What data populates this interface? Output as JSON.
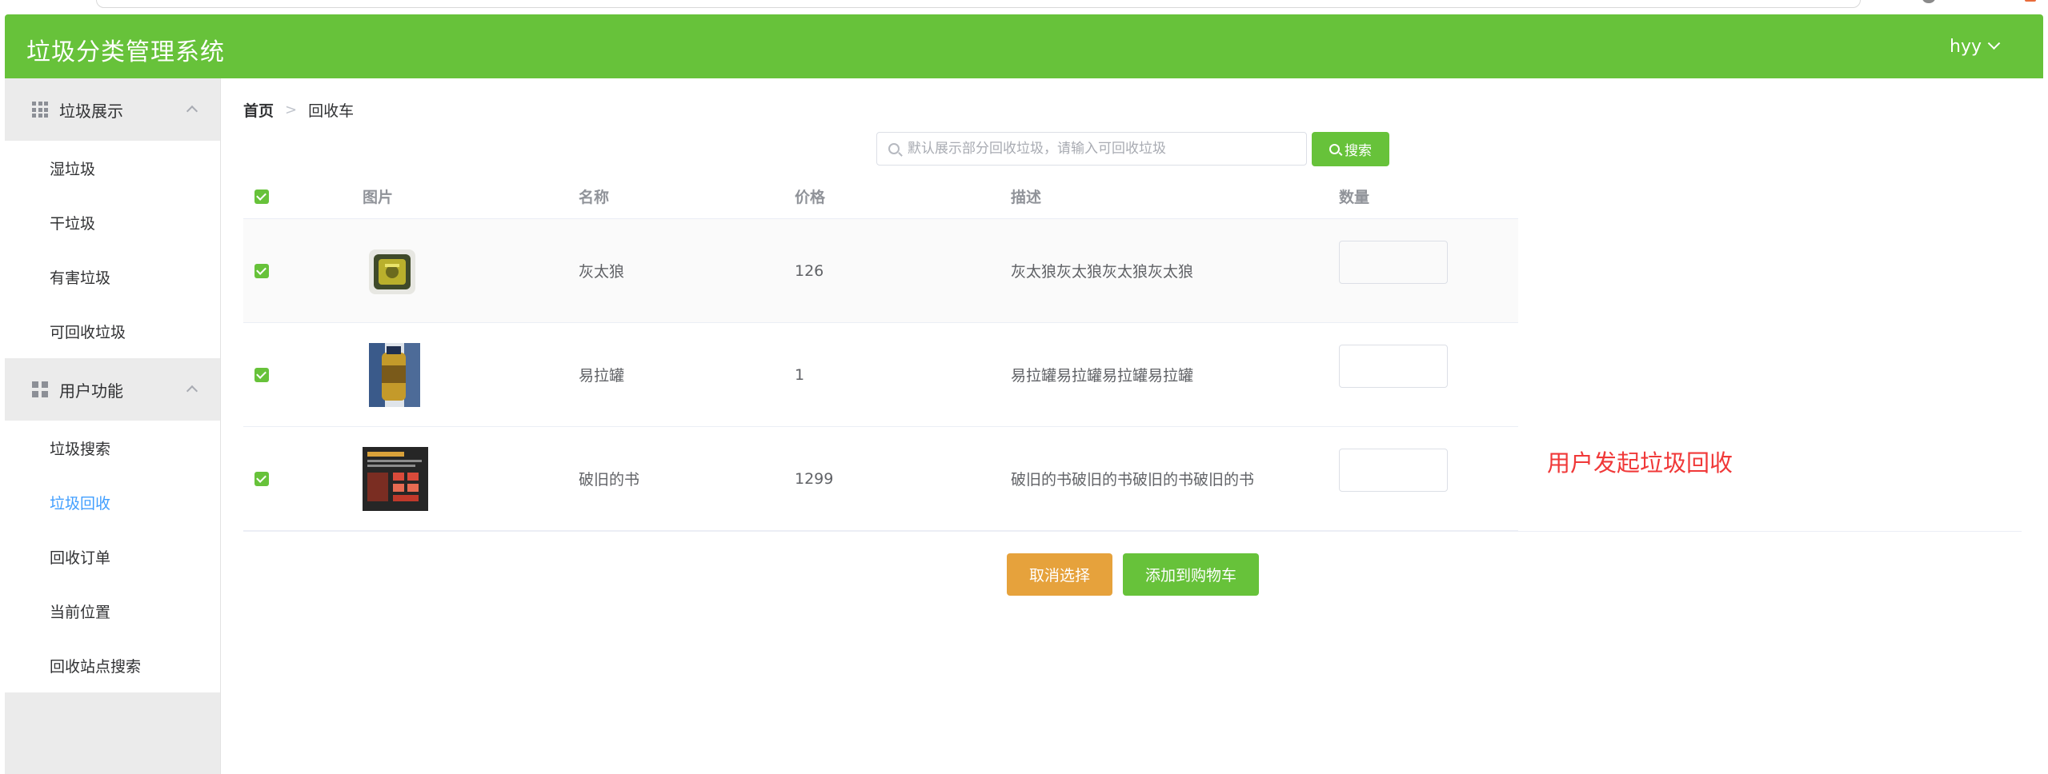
{
  "header": {
    "title": "垃圾分类管理系统",
    "user": "hyy"
  },
  "sidebar": {
    "groups": [
      {
        "label": "垃圾展示",
        "icon": "grid-icon",
        "items": [
          "湿垃圾",
          "干垃圾",
          "有害垃圾",
          "可回收垃圾"
        ]
      },
      {
        "label": "用户功能",
        "icon": "apps-icon",
        "items": [
          "垃圾搜索",
          "垃圾回收",
          "回收订单",
          "当前位置",
          "回收站点搜索"
        ]
      }
    ],
    "active_item": "垃圾回收"
  },
  "breadcrumb": {
    "home": "首页",
    "current": "回收车"
  },
  "search": {
    "placeholder": "默认展示部分回收垃圾，请输入可回收垃圾",
    "value": "",
    "button": "搜索"
  },
  "table": {
    "headers": {
      "image": "图片",
      "name": "名称",
      "price": "价格",
      "desc": "描述",
      "qty": "数量"
    },
    "rows": [
      {
        "name": "灰太狼",
        "price": "126",
        "desc": "灰太狼灰太狼灰太狼灰太狼",
        "qty": "",
        "checked": true
      },
      {
        "name": "易拉罐",
        "price": "1",
        "desc": "易拉罐易拉罐易拉罐易拉罐",
        "qty": "",
        "checked": true
      },
      {
        "name": "破旧的书",
        "price": "1299",
        "desc": "破旧的书破旧的书破旧的书破旧的书",
        "qty": "",
        "checked": true
      }
    ]
  },
  "actions": {
    "cancel": "取消选择",
    "add": "添加到购物车"
  },
  "annotation": "用户发起垃圾回收",
  "colors": {
    "primary_green": "#67c23a",
    "warning_orange": "#e6a23c",
    "active_blue": "#409eff",
    "annotation_red": "#f03838"
  }
}
